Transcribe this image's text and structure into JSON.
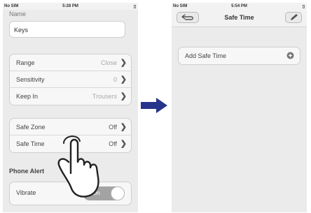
{
  "left_screen": {
    "status": {
      "carrier": "No SIM",
      "time": "5:28 PM",
      "battery": "▯"
    },
    "name_label": "Name",
    "name_value": "Keys",
    "settings": [
      {
        "label": "Range",
        "value": "Close"
      },
      {
        "label": "Sensitivity",
        "value": "0"
      },
      {
        "label": "Keep In",
        "value": "Trousers"
      }
    ],
    "safety": [
      {
        "label": "Safe Zone",
        "value": "Off"
      },
      {
        "label": "Safe Time",
        "value": "Off"
      }
    ],
    "phone_alert_title": "Phone Alert",
    "vibrate": {
      "label": "Vibrate",
      "state": "On"
    }
  },
  "right_screen": {
    "status": {
      "carrier": "No SIM",
      "time": "5:54 PM",
      "battery": "▯"
    },
    "nav_title": "Safe Time",
    "add_label": "Add Safe Time"
  },
  "icons": {
    "chevron": "chevron-right-icon",
    "back": "back-arrow-icon",
    "edit": "pencil-icon",
    "add": "plus-circle-icon",
    "hand": "pointing-hand-icon",
    "transition": "right-arrow-icon"
  },
  "colors": {
    "accent_arrow": "#27348b",
    "toggle_on": "#a3a3a3"
  }
}
